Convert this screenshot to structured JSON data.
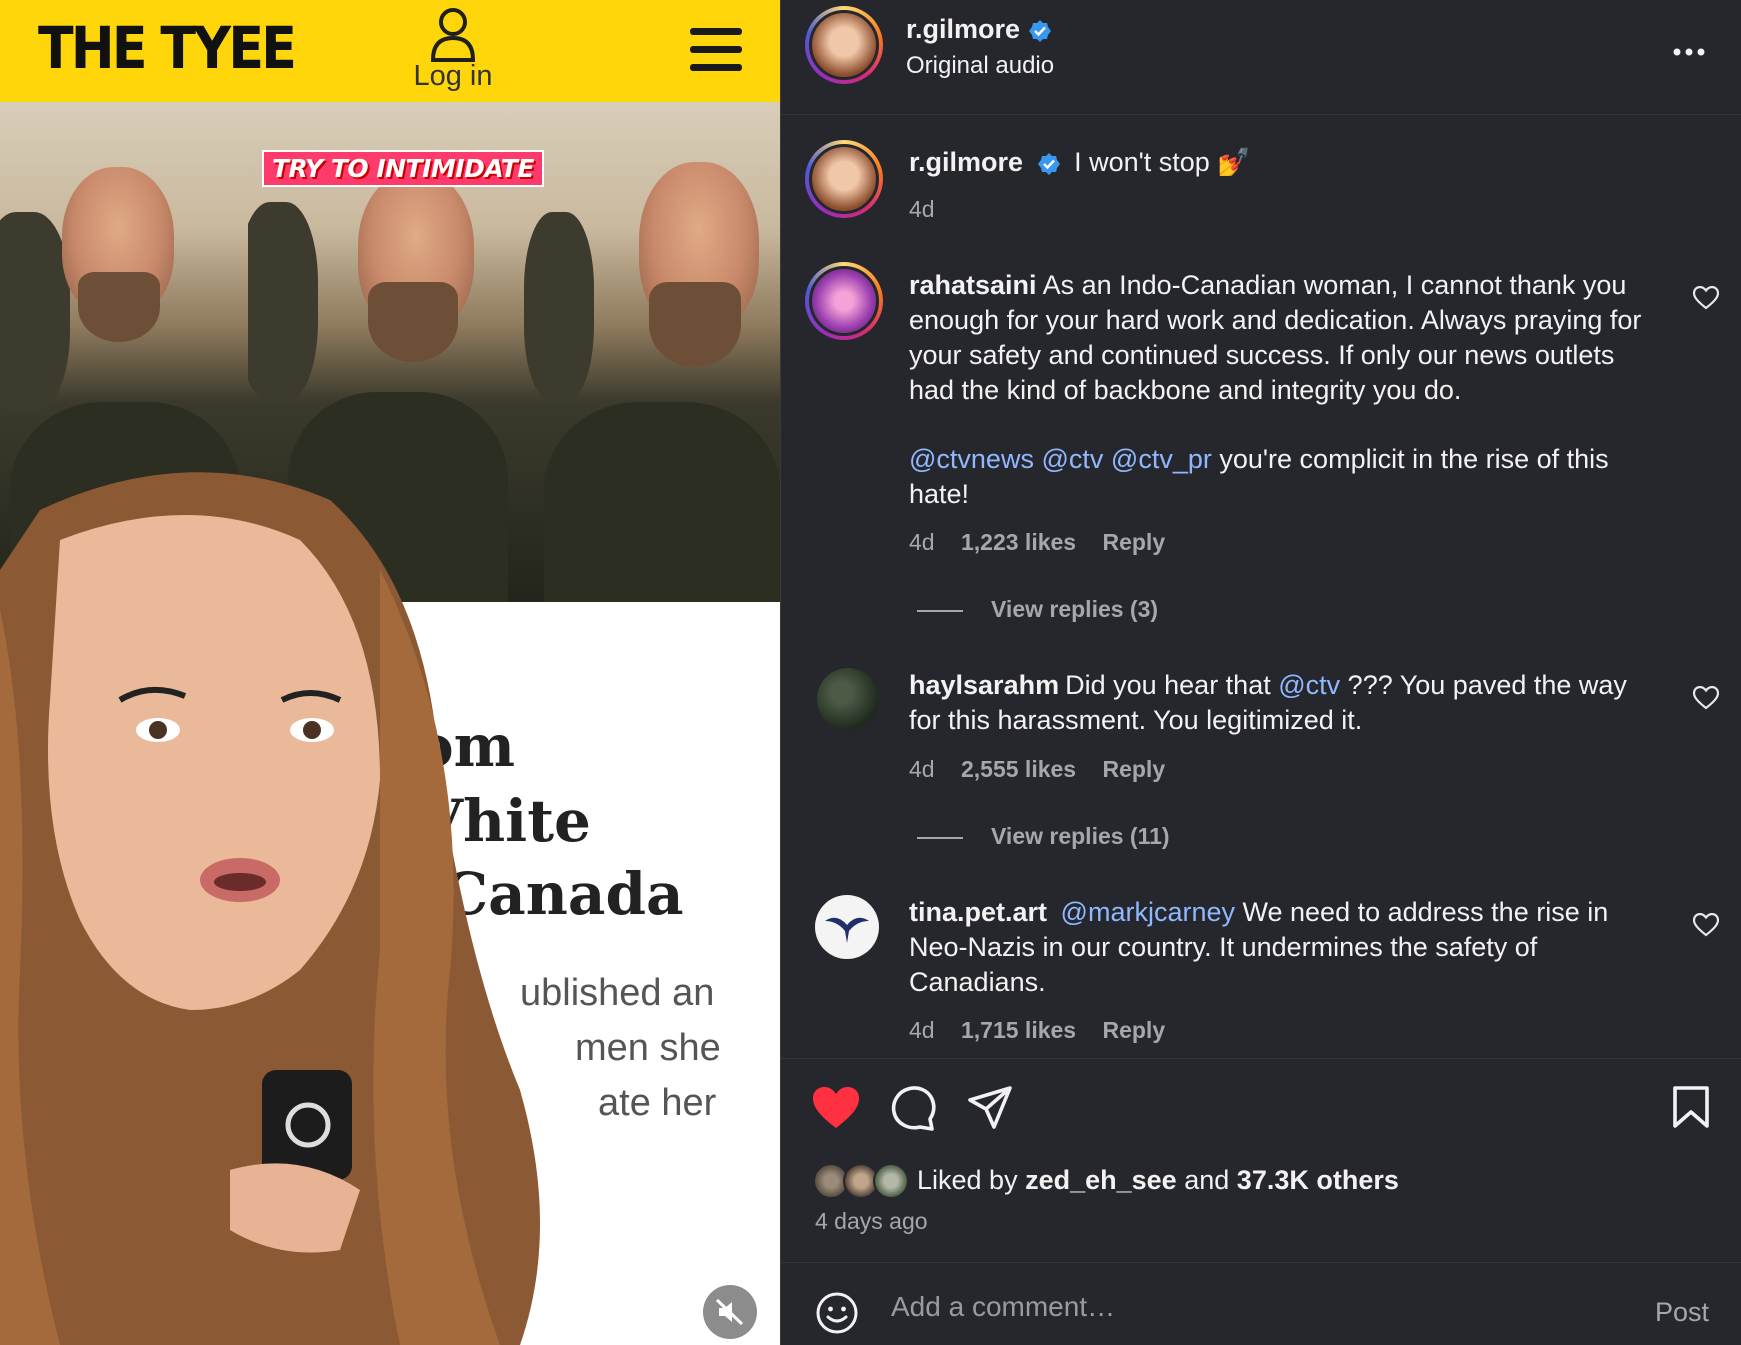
{
  "video": {
    "site_logo": "THE TYEE",
    "login_label": "Log in",
    "overlay_caption": "TRY TO INTIMIDATE",
    "article_fragments": {
      "headline_1": "om",
      "headline_2": "Vhite",
      "headline_3": "Canada",
      "body_1": "ublished an",
      "body_2": "men she",
      "body_3": "ate her"
    }
  },
  "post": {
    "author": "r.gilmore",
    "audio": "Original audio",
    "caption_user": "r.gilmore",
    "caption_text": "I won't stop 💅",
    "caption_time": "4d"
  },
  "comments": [
    {
      "user": "rahatsaini",
      "text_1": "As an Indo-Canadian woman, I cannot thank you enough for your hard work and dedication. Always praying for your safety and continued success. If only our news outlets had the kind of backbone and integrity you do.",
      "mentions": [
        "@ctvnews",
        "@ctv",
        "@ctv_pr"
      ],
      "text_2": "you're complicit in the rise of this hate!",
      "time": "4d",
      "likes": "1,223 likes",
      "reply": "Reply",
      "view_replies": "View replies (3)"
    },
    {
      "user": "haylsarahm",
      "text_before": "Did you hear that",
      "mention": "@ctv",
      "text_after": "??? You paved the way for this harassment. You legitimized it.",
      "time": "4d",
      "likes": "2,555 likes",
      "reply": "Reply",
      "view_replies": "View replies (11)"
    },
    {
      "user": "tina.pet.art",
      "mention": "@markjcarney",
      "text_after": "We need to address the rise in Neo-Nazis in our country. It undermines the safety of Canadians.",
      "time": "4d",
      "likes": "1,715 likes",
      "reply": "Reply"
    }
  ],
  "footer": {
    "liked_by_prefix": "Liked by",
    "liked_by_user": "zed_eh_see",
    "liked_by_and": "and",
    "liked_by_others": "37.3K others",
    "time_ago": "4 days ago",
    "comment_placeholder": "Add a comment…",
    "post_label": "Post"
  },
  "colors": {
    "tyee_yellow": "#ffd60a",
    "ig_background": "#26272d",
    "mention_blue": "#8fb8ff",
    "like_red": "#ff3040",
    "verified_blue": "#3897f0"
  },
  "icons": [
    "user-icon",
    "menu-icon",
    "mute-icon",
    "verified-icon",
    "more-icon",
    "heart-icon",
    "comment-icon",
    "share-icon",
    "bookmark-icon",
    "emoji-icon"
  ]
}
